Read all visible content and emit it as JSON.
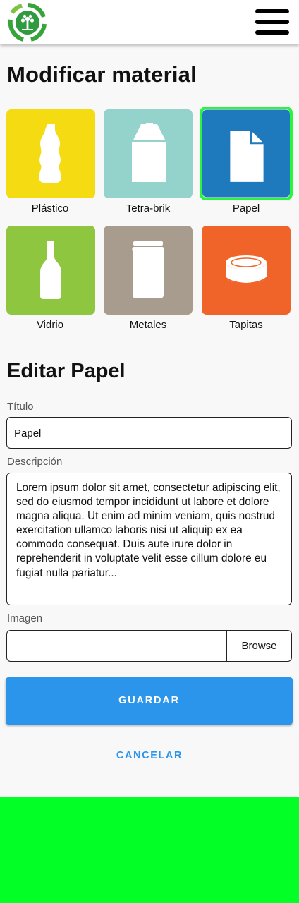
{
  "header": {
    "logo_icon": "recycle-tree-logo",
    "menu_icon": "hamburger-icon"
  },
  "page_title": "Modificar material",
  "materials": [
    {
      "label": "Plástico",
      "icon": "plastic-bottle-icon",
      "color": "#f5db11",
      "selected": false
    },
    {
      "label": "Tetra-brik",
      "icon": "tetra-brik-icon",
      "color": "#93d3cc",
      "selected": false
    },
    {
      "label": "Papel",
      "icon": "paper-icon",
      "color": "#1e79bd",
      "selected": true
    },
    {
      "label": "Vidrio",
      "icon": "glass-bottle-icon",
      "color": "#8ec640",
      "selected": false
    },
    {
      "label": "Metales",
      "icon": "metal-can-icon",
      "color": "#a89c8e",
      "selected": false
    },
    {
      "label": "Tapitas",
      "icon": "bottle-cap-icon",
      "color": "#f0642a",
      "selected": false
    }
  ],
  "edit": {
    "heading": "Editar Papel",
    "title_label": "Título",
    "title_value": "Papel",
    "description_label": "Descripción",
    "description_value": "Lorem ipsum dolor sit amet, consectetur adipiscing elit, sed do eiusmod tempor incididunt ut labore et dolore magna aliqua. Ut enim ad minim veniam, quis nostrud exercitation ullamco laboris nisi ut aliquip ex ea commodo consequat. Duis aute irure dolor in reprehenderit in voluptate velit esse cillum dolore eu fugiat nulla pariatur...",
    "image_label": "Imagen",
    "image_value": "",
    "browse_label": "Browse"
  },
  "actions": {
    "save_label": "GUARDAR",
    "cancel_label": "CANCELAR"
  },
  "colors": {
    "accent": "#2a95ea",
    "selection": "#28f53c",
    "footer": "#02ff25"
  }
}
